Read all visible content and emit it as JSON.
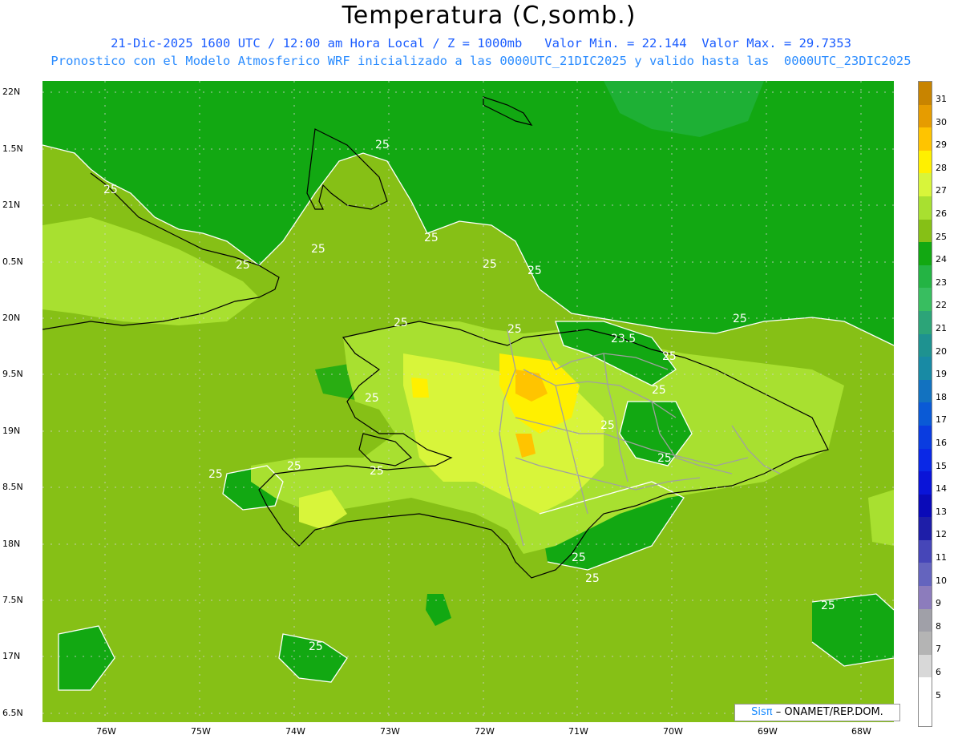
{
  "title": "Temperatura (C,somb.)",
  "subtitle1": "21-Dic-2025 1600 UTC / 12:00 am Hora Local / Z = 1000mb   Valor Min. = 22.144  Valor Max. = 29.7353",
  "subtitle2": "Pronostico con el Modelo Atmosferico WRF inicializado a las 0000UTC_21DIC2025 y valido hasta las  0000UTC_23DIC2025",
  "lat_labels": [
    "22N",
    "1.5N",
    "21N",
    "0.5N",
    "20N",
    "9.5N",
    "19N",
    "8.5N",
    "18N",
    "7.5N",
    "17N",
    "6.5N"
  ],
  "lon_labels": [
    "76W",
    "75W",
    "74W",
    "73W",
    "72W",
    "71W",
    "70W",
    "69W",
    "68W"
  ],
  "colorbar": {
    "labels": [
      "31",
      "30",
      "29",
      "28",
      "27",
      "26",
      "25",
      "24",
      "23",
      "22",
      "21",
      "20",
      "19",
      "18",
      "17",
      "16",
      "15",
      "14",
      "13",
      "12",
      "11",
      "10",
      "9",
      "8",
      "7",
      "6",
      "5"
    ],
    "colors": [
      "#c88400",
      "#e69c00",
      "#ffc400",
      "#fff000",
      "#d8f53a",
      "#a8e030",
      "#86c016",
      "#12a812",
      "#24b444",
      "#38be60",
      "#2ca478",
      "#1e9290",
      "#188aa4",
      "#1272c0",
      "#0a5ad6",
      "#0a3ce0",
      "#0a28e6",
      "#0a14d8",
      "#0a0ab8",
      "#1e1ea8",
      "#4646b8",
      "#6464be",
      "#8c7cbc",
      "#a0a0a8",
      "#b4b4b4",
      "#d8d8d8",
      "#ffffff"
    ]
  },
  "contour_labels": [
    "25",
    "25",
    "25",
    "25",
    "25",
    "25",
    "25",
    "25",
    "23.5",
    "25",
    "25",
    "25",
    "25",
    "25",
    "25",
    "25",
    "25",
    "25",
    "25",
    "25",
    "25",
    "25",
    "25"
  ],
  "logo": {
    "sis": "Sisπ",
    "rest": "– ONAMET/REP.DOM."
  }
}
